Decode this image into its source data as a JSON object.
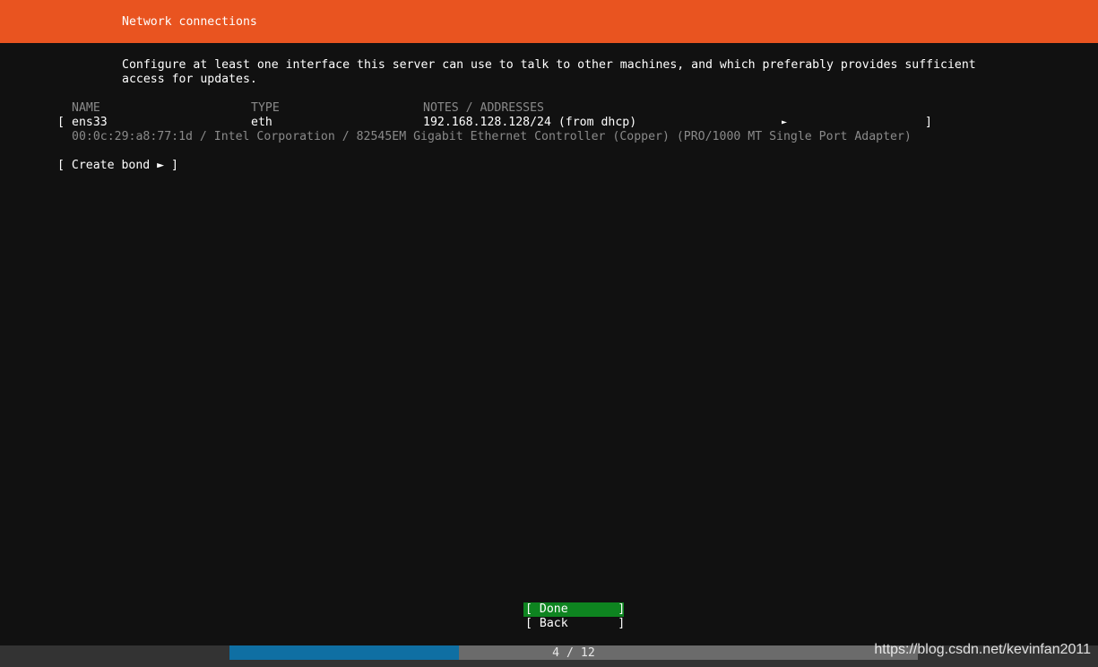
{
  "header": {
    "title": "Network connections"
  },
  "intro": {
    "line1": "Configure at least one interface this server can use to talk to other machines, and which preferably provides sufficient",
    "line2": "access for updates."
  },
  "table": {
    "columns": [
      "NAME",
      "TYPE",
      "NOTES / ADDRESSES"
    ],
    "rows": [
      {
        "open_bracket": "[",
        "name": "ens33",
        "type": "eth",
        "notes": "192.168.128.128/24 (from dhcp)",
        "arrow": "►",
        "close_bracket": "]",
        "detail": "00:0c:29:a8:77:1d / Intel Corporation / 82545EM Gigabit Ethernet Controller (Copper) (PRO/1000 MT Single Port Adapter)"
      }
    ]
  },
  "create_bond": {
    "label": "[ Create bond ► ]"
  },
  "buttons": {
    "done": "[ Done       ]",
    "back": "[ Back       ]"
  },
  "progress": {
    "current": 4,
    "total": 12,
    "label": "4 / 12"
  },
  "watermark": "https://blog.csdn.net/kevinfan2011",
  "colors": {
    "header": "#e95420",
    "background": "#111111",
    "done_button": "#0e8420",
    "progress_fill": "#0f6fa3",
    "progress_track": "#6b6b6b"
  }
}
